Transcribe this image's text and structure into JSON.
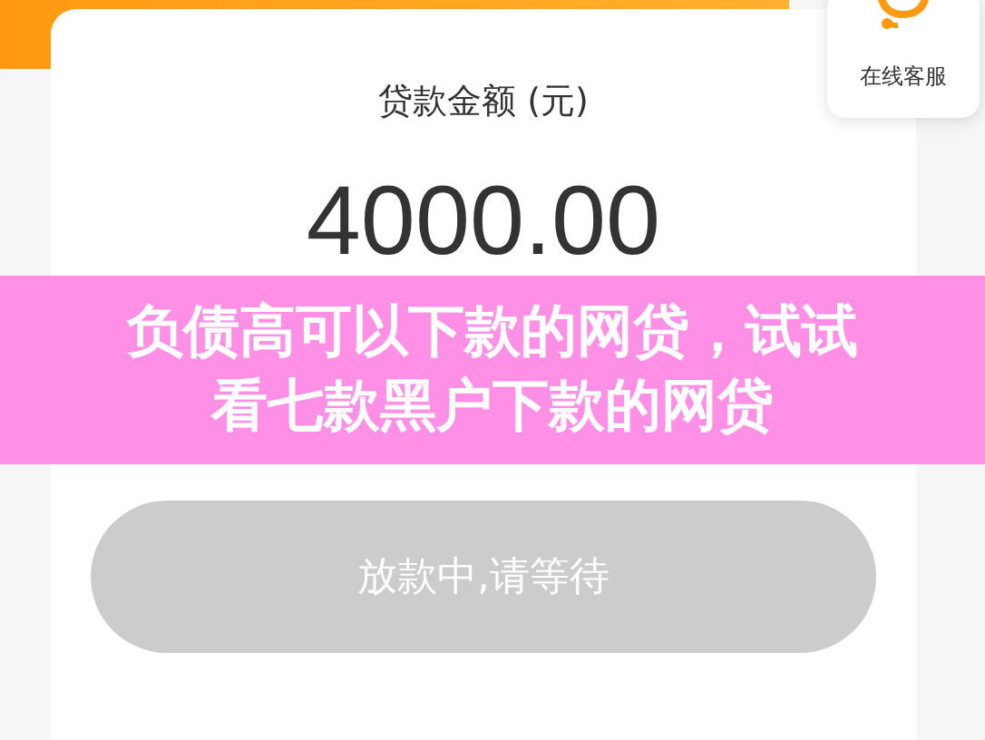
{
  "loan": {
    "label": "贷款金额 (元)",
    "amount": "4000.00"
  },
  "support": {
    "label": "在线客服"
  },
  "banner": {
    "lines": [
      "负债高可以下款的网贷，试试",
      "看七款黑户下款的网贷"
    ]
  },
  "submit_button": {
    "label": "放款中,请等待",
    "disabled": true
  }
}
